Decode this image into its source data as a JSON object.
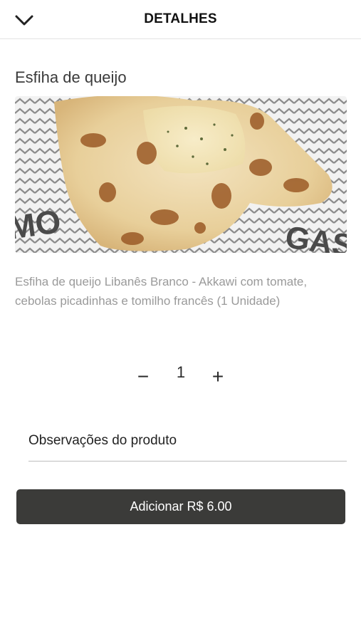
{
  "header": {
    "back_icon": "chevron-down-icon",
    "title": "DETALHES"
  },
  "product": {
    "name": "Esfiha de queijo",
    "description": "Esfiha de queijo Libanês Branco - Akkawi com tomate, cebolas picadinhas e tomilho francês (1 Unidade)"
  },
  "quantity": {
    "minus_label": "−",
    "value": "1",
    "plus_label": "+"
  },
  "observations": {
    "placeholder": "Observações do produto",
    "value": ""
  },
  "add_button": {
    "label": "Adicionar R$ 6.00"
  },
  "colors": {
    "button_bg": "#3b3b39",
    "description_text": "#9a9a9a"
  }
}
